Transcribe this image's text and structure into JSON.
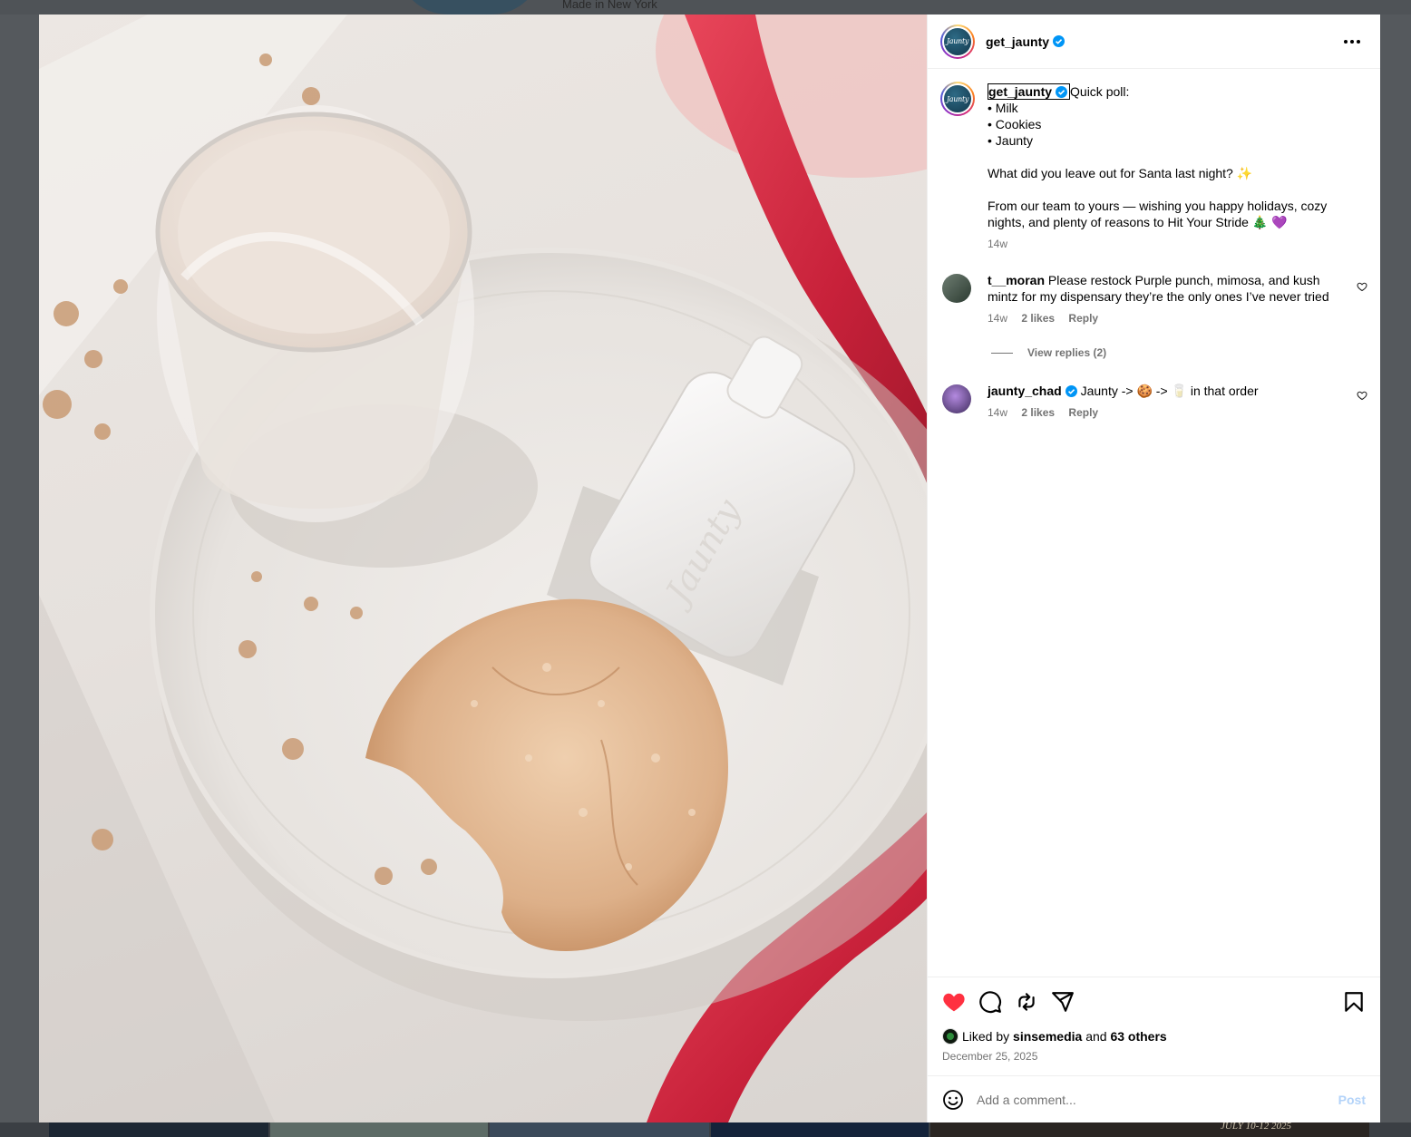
{
  "background": {
    "profile_location": "Made in New York",
    "thumb_date": "JULY 10-12 2025"
  },
  "post": {
    "username": "get_jaunty",
    "avatar_logo_text": "Jaunty",
    "product_label": "Jaunty",
    "more_icon": "more-horizontal-icon",
    "caption": {
      "username": "get_jaunty",
      "lines": [
        "Quick poll:",
        "• Milk",
        "• Cookies",
        "• Jaunty",
        "",
        "What did you leave out for Santa last night? ✨",
        "",
        "From our team to yours — wishing you happy holidays, cozy nights, and plenty of reasons to Hit Your Stride 🎄 💜"
      ],
      "time": "14w"
    },
    "comments": [
      {
        "username": "t__moran",
        "text": "Please restock Purple punch, mimosa, and kush mintz for my dispensary they’re the only ones I’ve never tried",
        "time": "14w",
        "likes": "2 likes",
        "reply_label": "Reply",
        "view_replies": "View replies (2)"
      },
      {
        "username": "jaunty_chad",
        "text": "Jaunty -> 🍪 -> 🥛 in that order",
        "time": "14w",
        "likes": "2 likes",
        "reply_label": "Reply"
      }
    ],
    "liked_by": {
      "prefix": "Liked by",
      "user": "sinsemedia",
      "conj": "and",
      "others": "63 others"
    },
    "date": "December 25, 2025",
    "comment_input": {
      "placeholder": "Add a comment...",
      "value": ""
    },
    "post_button": "Post"
  },
  "colors": {
    "like_red": "#ff3040",
    "verified_blue": "#0095f6",
    "post_disabled": "#b3d3f9",
    "ribbon": "#d0283a"
  },
  "icons": [
    "heart-filled-icon",
    "comment-icon",
    "repost-icon",
    "share-icon",
    "bookmark-icon",
    "emoji-icon",
    "verified-badge-icon"
  ]
}
